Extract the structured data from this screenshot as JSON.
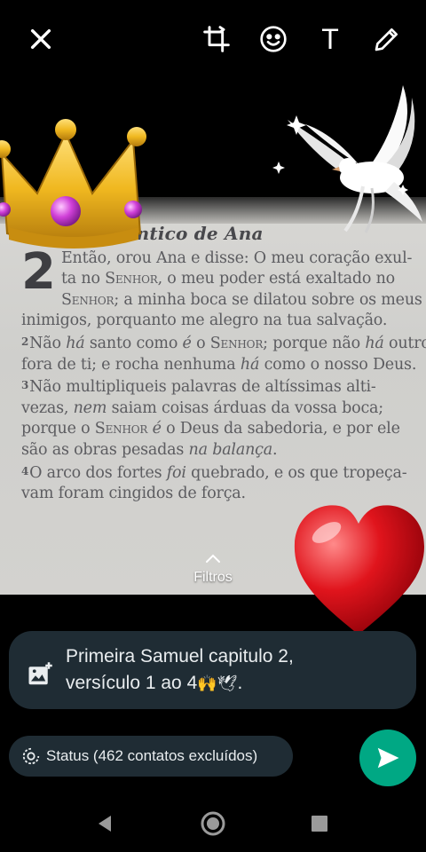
{
  "toolbar": {
    "close_icon": "close-icon",
    "crop_icon": "crop-rotate-icon",
    "emoji_icon": "emoji-sticker-icon",
    "text_icon_glyph": "T",
    "draw_icon": "pencil-icon"
  },
  "photo": {
    "heading": "O cântico de Ana",
    "chapter": "2",
    "lines": [
      [
        "Então, orou Ana e disse: O meu coração exul-"
      ],
      [
        "ta no ",
        {
          "sc": "Senhor"
        },
        ", o meu poder está exaltado no"
      ],
      [
        {
          "sc": "Senhor"
        },
        "; a minha boca se dilatou sobre os meus"
      ],
      [
        "inimigos, porquanto me alegro na tua salvação."
      ],
      [
        {
          "vn": "2"
        },
        "Não ",
        {
          "it": "há"
        },
        " santo como ",
        {
          "it": "é"
        },
        " o ",
        {
          "sc": "Senhor"
        },
        "; porque não ",
        {
          "it": "há"
        },
        " outro"
      ],
      [
        "fora de ti; e rocha nenhuma ",
        {
          "it": "há"
        },
        " como o nosso Deus."
      ],
      [
        {
          "vn": "3"
        },
        "Não multipliqueis palavras de altíssimas alti-"
      ],
      [
        "vezas, ",
        {
          "it": "nem"
        },
        " saiam coisas árduas da vossa boca;"
      ],
      [
        "porque o ",
        {
          "sc": "Senhor"
        },
        " ",
        {
          "it": "é"
        },
        " o Deus da sabedoria, e por ele"
      ],
      [
        "são as obras pesadas ",
        {
          "it": "na balança"
        },
        "."
      ],
      [
        {
          "vn": "4"
        },
        "O arco dos fortes ",
        {
          "it": "foi"
        },
        " quebrado, e os que tropeça-"
      ],
      [
        "vam foram cingidos de força."
      ]
    ]
  },
  "stickers": {
    "crown": "crown-sticker",
    "dove": "dove-sticker",
    "heart": "heart-sticker"
  },
  "filters": {
    "label": "Filtros",
    "icon": "chevron-up-icon"
  },
  "caption": {
    "line1": "Primeira Samuel capitulo 2,",
    "line2": "versículo 1 ao 4",
    "emoji": "🙌🕊",
    "end": ".",
    "icon": "add-media-icon"
  },
  "status": {
    "label": "Status (462 contatos excluídos)",
    "icon": "status-ring-icon"
  },
  "send": {
    "icon": "send-icon",
    "color": "#00a884"
  },
  "navbar": {
    "back_icon": "nav-back-icon",
    "home_icon": "nav-home-icon",
    "recents_icon": "nav-recents-icon"
  },
  "colors": {
    "panel": "#1f2c34",
    "accent": "#00a884"
  }
}
